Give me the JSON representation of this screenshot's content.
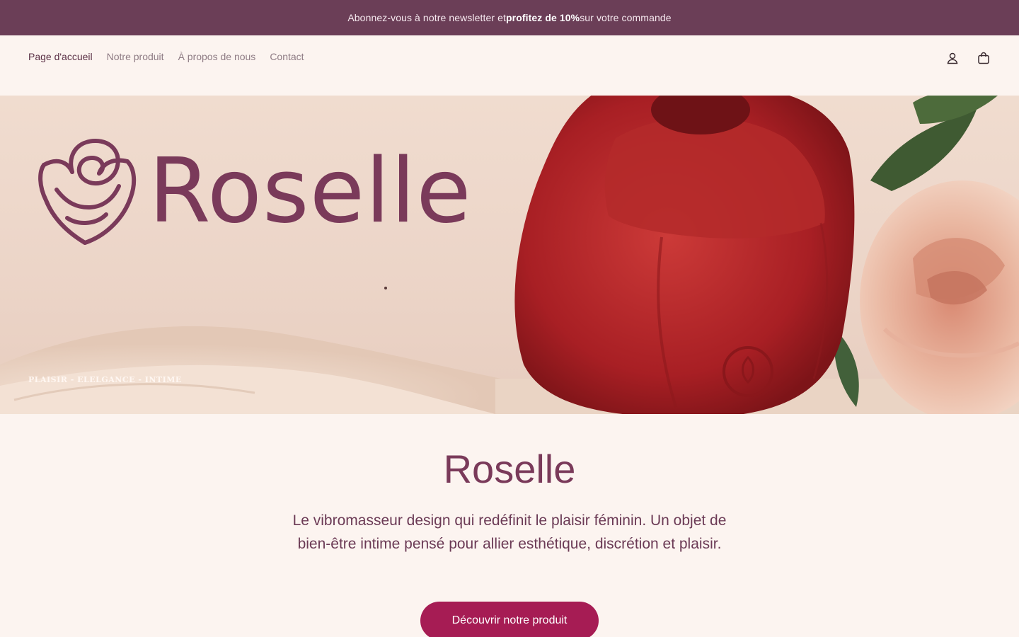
{
  "announcement": {
    "prefix": "Abonnez-vous à notre newsletter et ",
    "highlight": "profitez de 10%",
    "suffix": " sur votre commande"
  },
  "nav": {
    "items": [
      {
        "label": "Page d'accueil",
        "active": true
      },
      {
        "label": "Notre produit",
        "active": false
      },
      {
        "label": "À propos de nous",
        "active": false
      },
      {
        "label": "Contact",
        "active": false
      }
    ]
  },
  "header_icons": [
    "account-icon",
    "cart-icon"
  ],
  "hero": {
    "brand_name": "Roselle",
    "logo_icon": "rose-logo-icon",
    "tagline": "PLAISIR - ELELGANCE - INTIME"
  },
  "main": {
    "title": "Roselle",
    "description": "Le vibromasseur design qui redéfinit le plaisir féminin. Un objet de bien-être intime pensé pour allier esthétique, discrétion et plaisir.",
    "cta_label": "Découvrir notre produit"
  },
  "colors": {
    "announcement_bg": "#6b3e57",
    "page_bg": "#fcf4f0",
    "brand_plum": "#7a3a5a",
    "cta_bg": "#a61c54"
  }
}
